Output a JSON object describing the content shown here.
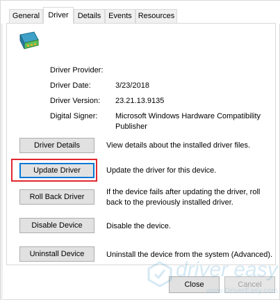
{
  "tabs": [
    {
      "label": "General"
    },
    {
      "label": "Driver"
    },
    {
      "label": "Details"
    },
    {
      "label": "Events"
    },
    {
      "label": "Resources"
    }
  ],
  "active_tab": "Driver",
  "device_icon": "display-adapter-icon",
  "info": {
    "provider_label": "Driver Provider:",
    "provider_value": "",
    "date_label": "Driver Date:",
    "date_value": "3/23/2018",
    "version_label": "Driver Version:",
    "version_value": "23.21.13.9135",
    "signer_label": "Digital Signer:",
    "signer_value": "Microsoft Windows Hardware Compatibility Publisher"
  },
  "actions": [
    {
      "label": "Driver Details",
      "desc": "View details about the installed driver files."
    },
    {
      "label": "Update Driver",
      "desc": "Update the driver for this device."
    },
    {
      "label": "Roll Back Driver",
      "desc": "If the device fails after updating the driver, roll back to the previously installed driver."
    },
    {
      "label": "Disable Device",
      "desc": "Disable the device."
    },
    {
      "label": "Uninstall Device",
      "desc": "Uninstall the device from the system (Advanced)."
    }
  ],
  "footer": {
    "close_label": "Close",
    "cancel_label": "Cancel"
  },
  "watermark": {
    "brand": "driver easy",
    "url": "www.DriverEasy.com"
  },
  "colors": {
    "highlight": "#e0262f",
    "focus": "#0078d7"
  }
}
